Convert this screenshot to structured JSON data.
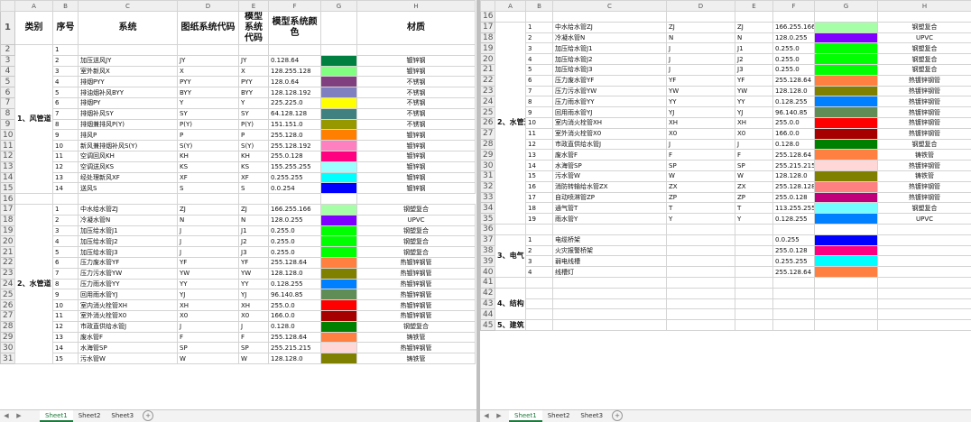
{
  "columns": [
    "A",
    "B",
    "C",
    "D",
    "E",
    "F",
    "G",
    "H"
  ],
  "headers": {
    "category": "类别",
    "index": "序号",
    "system": "系统",
    "drawing_code": "图纸系统代码",
    "model_code": "模型系统代码",
    "model_color": "模型系统颜色",
    "material": "材质"
  },
  "categories": {
    "air": "1、风管道",
    "water": "2、水管道",
    "electric": "3、电气",
    "structure": "4、结构",
    "building": "5、建筑"
  },
  "sheet_tabs": [
    "Sheet1",
    "Sheet2",
    "Sheet3"
  ],
  "nav_arrows": {
    "prev": "◀",
    "next": "▶",
    "add": "+"
  },
  "air_rows": [
    {
      "n": "1",
      "sys": "",
      "d": "",
      "e": "",
      "f": "",
      "color": "",
      "m": ""
    },
    {
      "n": "2",
      "sys": "加压送风JY",
      "d": "JY",
      "e": "JY",
      "f": "0.128.64",
      "color": "#008040",
      "m": "镀锌钢"
    },
    {
      "n": "3",
      "sys": "室外新风X",
      "d": "X",
      "e": "X",
      "f": "128.255.128",
      "color": "#80ff80",
      "m": "镀锌钢"
    },
    {
      "n": "4",
      "sys": "排烟PYY",
      "d": "PYY",
      "e": "PYY",
      "f": "128.0.64",
      "color": "#804080",
      "m": "不锈钢"
    },
    {
      "n": "5",
      "sys": "排油烟补风BYY",
      "d": "BYY",
      "e": "BYY",
      "f": "128.128.192",
      "color": "#8080c0",
      "m": "不锈钢"
    },
    {
      "n": "6",
      "sys": "排烟PY",
      "d": "Y",
      "e": "Y",
      "f": "225.225.0",
      "color": "#ffff00",
      "m": "不锈钢"
    },
    {
      "n": "7",
      "sys": "排烟补风SY",
      "d": "SY",
      "e": "SY",
      "f": "64.128.128",
      "color": "#408080",
      "m": "不锈钢"
    },
    {
      "n": "8",
      "sys": "排烟兼排风P(Y)",
      "d": "P(Y)",
      "e": "P(Y)",
      "f": "151.151.0",
      "color": "#979700",
      "m": "不锈钢"
    },
    {
      "n": "9",
      "sys": "排风P",
      "d": "P",
      "e": "P",
      "f": "255.128.0",
      "color": "#ff8000",
      "m": "镀锌钢"
    },
    {
      "n": "10",
      "sys": "新风兼排烟补风S(Y)",
      "d": "S(Y)",
      "e": "S(Y)",
      "f": "255.128.192",
      "color": "#ff80c0",
      "m": "镀锌钢"
    },
    {
      "n": "11",
      "sys": "空调回风KH",
      "d": "KH",
      "e": "KH",
      "f": "255.0.128",
      "color": "#ff0080",
      "m": "镀锌钢"
    },
    {
      "n": "12",
      "sys": "空调送风KS",
      "d": "KS",
      "e": "KS",
      "f": "155.255.255",
      "color": "#9bffff",
      "m": "镀锌钢"
    },
    {
      "n": "13",
      "sys": "经处理新风XF",
      "d": "XF",
      "e": "XF",
      "f": "0.255.255",
      "color": "#00ffff",
      "m": "镀锌钢"
    },
    {
      "n": "14",
      "sys": "送风S",
      "d": "S",
      "e": "S",
      "f": "0.0.254",
      "color": "#0000fe",
      "m": "镀锌钢"
    }
  ],
  "water_rows": [
    {
      "n": "1",
      "sys": "中水给水管ZJ",
      "d": "ZJ",
      "e": "ZJ",
      "f": "166.255.166",
      "color": "#a6ffa6",
      "m": "钢塑复合"
    },
    {
      "n": "2",
      "sys": "冷凝水管N",
      "d": "N",
      "e": "N",
      "f": "128.0.255",
      "color": "#8000ff",
      "m": "UPVC"
    },
    {
      "n": "3",
      "sys": "加压给水管J1",
      "d": "J",
      "e": "J1",
      "f": "0.255.0",
      "color": "#00ff00",
      "m": "钢塑复合"
    },
    {
      "n": "4",
      "sys": "加压给水管J2",
      "d": "J",
      "e": "J2",
      "f": "0.255.0",
      "color": "#00ff00",
      "m": "钢塑复合"
    },
    {
      "n": "5",
      "sys": "加压给水管J3",
      "d": "J",
      "e": "J3",
      "f": "0.255.0",
      "color": "#00ff00",
      "m": "钢塑复合"
    },
    {
      "n": "6",
      "sys": "压力废水管YF",
      "d": "YF",
      "e": "YF",
      "f": "255.128.64",
      "color": "#ff8040",
      "m": "热镀锌钢管"
    },
    {
      "n": "7",
      "sys": "压力污水管YW",
      "d": "YW",
      "e": "YW",
      "f": "128.128.0",
      "color": "#808000",
      "m": "热镀锌钢管"
    },
    {
      "n": "8",
      "sys": "压力雨水管YY",
      "d": "YY",
      "e": "YY",
      "f": "0.128.255",
      "color": "#0080ff",
      "m": "热镀锌钢管"
    },
    {
      "n": "9",
      "sys": "回用雨水管YJ",
      "d": "YJ",
      "e": "YJ",
      "f": "96.140.85",
      "color": "#608c55",
      "m": "热镀锌钢管"
    },
    {
      "n": "10",
      "sys": "室内消火栓管XH",
      "d": "XH",
      "e": "XH",
      "f": "255.0.0",
      "color": "#ff0000",
      "m": "热镀锌钢管"
    },
    {
      "n": "11",
      "sys": "室外消火栓管X0",
      "d": "X0",
      "e": "X0",
      "f": "166.0.0",
      "color": "#a60000",
      "m": "热镀锌钢管"
    },
    {
      "n": "12",
      "sys": "市政直供给水管J",
      "d": "J",
      "e": "J",
      "f": "0.128.0",
      "color": "#008000",
      "m": "钢塑复合"
    },
    {
      "n": "13",
      "sys": "废水管F",
      "d": "F",
      "e": "F",
      "f": "255.128.64",
      "color": "#ff8040",
      "m": "铸铁管"
    },
    {
      "n": "14",
      "sys": "水海管SP",
      "d": "SP",
      "e": "SP",
      "f": "255.215.215",
      "color": "#ffd7d7",
      "m": "热镀锌钢管"
    },
    {
      "n": "15",
      "sys": "污水管W",
      "d": "W",
      "e": "W",
      "f": "128.128.0",
      "color": "#808000",
      "m": "铸铁管"
    },
    {
      "n": "16",
      "sys": "消防转输给水管ZX",
      "d": "ZX",
      "e": "ZX",
      "f": "255.128.128",
      "color": "#ff8080",
      "m": "热镀锌钢管"
    },
    {
      "n": "17",
      "sys": "自动喷淋管ZP",
      "d": "ZP",
      "e": "ZP",
      "f": "255.0.128",
      "color": "#c0007a",
      "m": "热镀锌钢管"
    },
    {
      "n": "18",
      "sys": "通气管T",
      "d": "T",
      "e": "T",
      "f": "113.255.255",
      "color": "#71ffff",
      "m": "钢塑复合"
    },
    {
      "n": "19",
      "sys": "雨水管Y",
      "d": "Y",
      "e": "Y",
      "f": "0.128.255",
      "color": "#0080ff",
      "m": "UPVC"
    }
  ],
  "electric_rows": [
    {
      "n": "1",
      "sys": "电缆桥架",
      "d": "",
      "e": "",
      "f": "0.0.255",
      "color": "#0000ff",
      "m": ""
    },
    {
      "n": "2",
      "sys": "火灾报警桥架",
      "d": "",
      "e": "",
      "f": "255.0.128",
      "color": "#ff0080",
      "m": ""
    },
    {
      "n": "3",
      "sys": "弱电线槽",
      "d": "",
      "e": "",
      "f": "0.255.255",
      "color": "#00ffff",
      "m": ""
    },
    {
      "n": "4",
      "sys": "线槽灯",
      "d": "",
      "e": "",
      "f": "255.128.64",
      "color": "#ff8040",
      "m": ""
    }
  ]
}
